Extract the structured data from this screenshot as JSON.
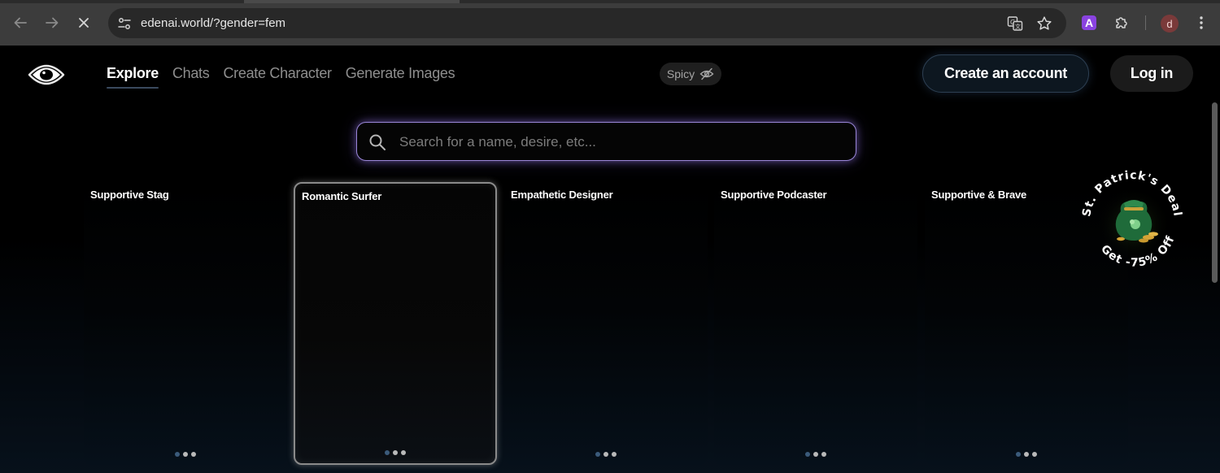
{
  "browser": {
    "url": "edenai.world/?gender=fem",
    "profile_initial": "d",
    "extension_label": "A"
  },
  "header": {
    "nav": [
      {
        "label": "Explore",
        "active": true
      },
      {
        "label": "Chats",
        "active": false
      },
      {
        "label": "Create Character",
        "active": false
      },
      {
        "label": "Generate Images",
        "active": false
      }
    ],
    "spicy_label": "Spicy",
    "create_account_label": "Create an account",
    "login_label": "Log in"
  },
  "search": {
    "placeholder": "Search for a name, desire, etc..."
  },
  "cards": [
    {
      "title": "Supportive Stag"
    },
    {
      "title": "Romantic Surfer",
      "selected": true
    },
    {
      "title": "Empathetic Designer"
    },
    {
      "title": "Supportive Podcaster"
    },
    {
      "title": "Supportive & Brave"
    }
  ],
  "promo": {
    "top_text": "St. Patrick's Deal",
    "bottom_text": "Get -75% Off"
  },
  "colors": {
    "accent_glow": "#9a86d8",
    "page_bg": "#000000",
    "chrome_bg": "#3c3c3c"
  }
}
